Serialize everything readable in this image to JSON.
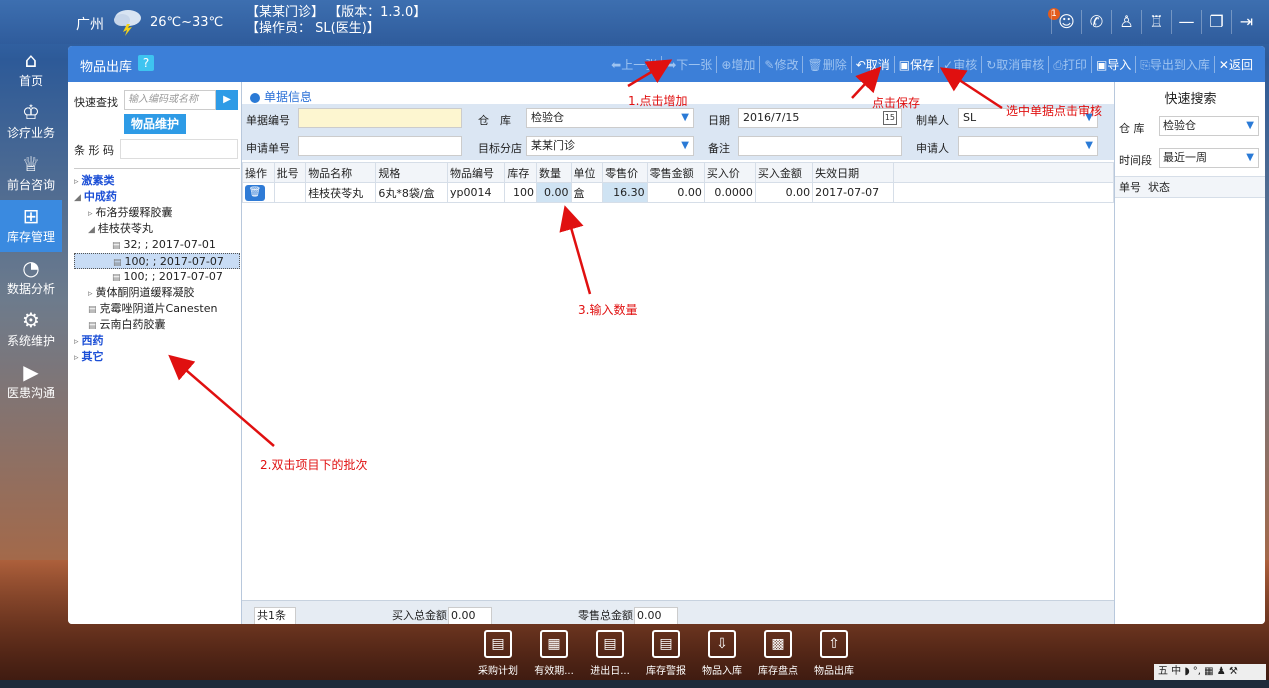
{
  "header": {
    "city": "广州",
    "temperature": "26℃~33℃",
    "clinic_line": "【某某门诊】 【版本：1.3.0】",
    "operator_line": "【操作员： SL(医生)】",
    "notification_count": "1"
  },
  "nav": [
    {
      "label": "首页",
      "icon": "home-icon"
    },
    {
      "label": "诊疗业务",
      "icon": "doctor-icon"
    },
    {
      "label": "前台咨询",
      "icon": "reception-icon"
    },
    {
      "label": "库存管理",
      "icon": "store-icon",
      "active": true
    },
    {
      "label": "数据分析",
      "icon": "chart-icon"
    },
    {
      "label": "系统维护",
      "icon": "gear-icon"
    },
    {
      "label": "医患沟通",
      "icon": "video-icon"
    }
  ],
  "window": {
    "title": "物品出库",
    "help": "?"
  },
  "toolbar": {
    "prev": "上一张",
    "next": "下一张",
    "add": "增加",
    "edit": "修改",
    "delete": "删除",
    "cancel": "取消",
    "save": "保存",
    "audit": "审核",
    "unaudit": "取消审核",
    "print": "打印",
    "import": "导入",
    "export": "导出到入库",
    "back": "返回"
  },
  "left": {
    "search_label": "快速查找",
    "search_placeholder": "输入编码或名称",
    "maint_button": "物品维护",
    "barcode_label": "条 形 码",
    "tree": [
      {
        "text": "激素类",
        "level": 0,
        "blue": true,
        "mark": "▹"
      },
      {
        "text": "中成药",
        "level": 0,
        "blue": true,
        "mark": "◢"
      },
      {
        "text": "布洛芬缓释胶囊",
        "level": 1,
        "mark": "▹"
      },
      {
        "text": "桂枝茯苓丸",
        "level": 1,
        "mark": "◢"
      },
      {
        "text": "32; ; 2017-07-01",
        "level": 2,
        "mark": "▤"
      },
      {
        "text": "100; ; 2017-07-07",
        "level": 2,
        "mark": "▤",
        "selected": true
      },
      {
        "text": "100; ; 2017-07-07",
        "level": 2,
        "mark": "▤"
      },
      {
        "text": "黄体酮阴道缓释凝胶",
        "level": 1,
        "mark": "▹"
      },
      {
        "text": "克霉唑阴道片Canesten",
        "level": 1,
        "mark": "▤"
      },
      {
        "text": "云南白药胶囊",
        "level": 1,
        "mark": "▤"
      },
      {
        "text": "西药",
        "level": 0,
        "blue": true,
        "mark": "▹"
      },
      {
        "text": "其它",
        "level": 0,
        "blue": true,
        "mark": "▹"
      }
    ]
  },
  "form": {
    "section": "单据信息",
    "doc_no_label": "单据编号",
    "doc_no": "",
    "warehouse_label": "仓　库",
    "warehouse": "检验仓",
    "date_label": "日期",
    "date": "2016/7/15",
    "calendar_day": "15",
    "maker_label": "制单人",
    "maker": "SL",
    "apply_no_label": "申请单号",
    "apply_no": "",
    "target_label": "目标分店",
    "target": "某某门诊",
    "remark_label": "备注",
    "remark": "",
    "applicant_label": "申请人",
    "applicant": ""
  },
  "grid": {
    "columns": [
      "操作",
      "批号",
      "物品名称",
      "规格",
      "物品编号",
      "库存",
      "数量",
      "单位",
      "零售价",
      "零售金额",
      "买入价",
      "买入金额",
      "失效日期"
    ],
    "rows": [
      {
        "batch": "",
        "name": "桂枝茯苓丸",
        "spec": "6丸*8袋/盒",
        "code": "yp0014",
        "stock": "100",
        "qty": "0.00",
        "unit": "盒",
        "retail": "16.30",
        "retail_amt": "0.00",
        "buy": "0.0000",
        "buy_amt": "0.00",
        "expiry": "2017-07-07"
      }
    ]
  },
  "footer": {
    "count": "共1条",
    "buy_total_label": "买入总金额",
    "buy_total": "0.00",
    "retail_total_label": "零售总金额",
    "retail_total": "0.00"
  },
  "right": {
    "title": "快速搜索",
    "warehouse_label": "仓 库",
    "warehouse": "检验仓",
    "period_label": "时间段",
    "period": "最近一周",
    "col_no": "单号",
    "col_status": "状态"
  },
  "annotations": {
    "a1": "1.点击增加",
    "a_save": "点击保存",
    "a_audit": "选中单据点击审核",
    "a2": "2.双击项目下的批次",
    "a3": "3.输入数量"
  },
  "dock": [
    "采购计划",
    "有效期...",
    "进出日...",
    "库存警报",
    "物品入库",
    "库存盘点",
    "物品出库"
  ],
  "tray": "五 中 ◗ °, ▦ ♟ ⚒"
}
